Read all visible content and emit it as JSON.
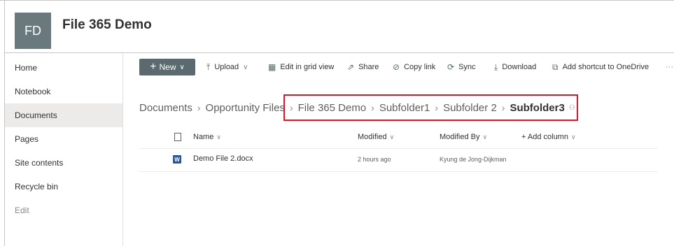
{
  "site": {
    "logo_initials": "FD",
    "title": "File 365 Demo"
  },
  "nav": {
    "items": [
      {
        "label": "Home",
        "selected": false
      },
      {
        "label": "Notebook",
        "selected": false
      },
      {
        "label": "Documents",
        "selected": true
      },
      {
        "label": "Pages",
        "selected": false
      },
      {
        "label": "Site contents",
        "selected": false
      },
      {
        "label": "Recycle bin",
        "selected": false
      },
      {
        "label": "Edit",
        "selected": false
      }
    ]
  },
  "commandbar": {
    "new_label": "New",
    "upload_label": "Upload",
    "edit_grid_label": "Edit in grid view",
    "share_label": "Share",
    "copy_link_label": "Copy link",
    "sync_label": "Sync",
    "download_label": "Download",
    "add_shortcut_label": "Add shortcut to OneDrive",
    "more_label": "···"
  },
  "breadcrumb": {
    "items": [
      "Documents",
      "Opportunity Files",
      "File 365 Demo",
      "Subfolder1",
      "Subfolder 2",
      "Subfolder3"
    ]
  },
  "table": {
    "columns": {
      "name": "Name",
      "modified": "Modified",
      "modified_by": "Modified By",
      "add_column": "+ Add column"
    },
    "rows": [
      {
        "name": "Demo File 2.docx",
        "modified": "2 hours ago",
        "modified_by": "Kyung de Jong-Dijkman",
        "file_icon": "word-icon"
      }
    ]
  },
  "colors": {
    "accent": "#5a6a6e",
    "highlight": "#e81123",
    "logo_bg": "#69797e"
  }
}
